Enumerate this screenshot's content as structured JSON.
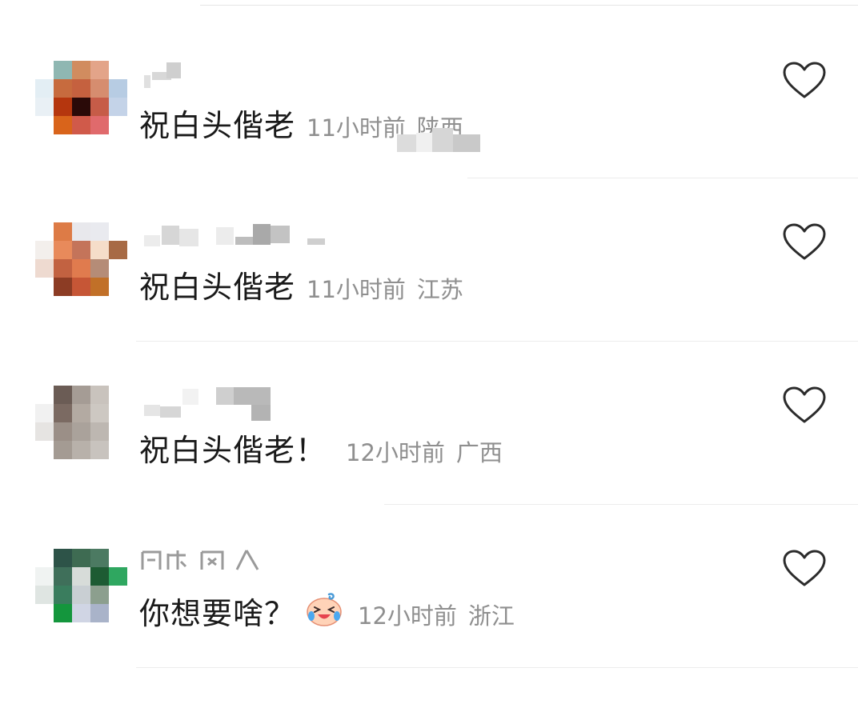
{
  "comments": [
    {
      "text": "祝白头偕老",
      "time": "11小时前",
      "location": "陕西"
    },
    {
      "text": "祝白头偕老",
      "time": "11小时前",
      "location": "江苏"
    },
    {
      "text": "祝白头偕老！",
      "time": "12小时前",
      "location": "广西"
    },
    {
      "text": "你想要啥？",
      "time": "12小时前",
      "location": "浙江",
      "emoji": "crying-laughing-baby-emoji"
    }
  ],
  "icons": {
    "like": "heart-outline-icon"
  },
  "colors": {
    "text": "#1a1a1a",
    "meta": "#8f8f8f",
    "divider": "#ececec"
  }
}
